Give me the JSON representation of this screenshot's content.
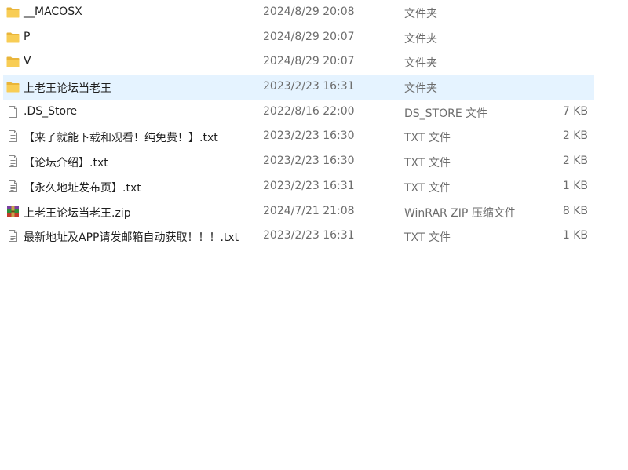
{
  "files": [
    {
      "name": "__MACOSX",
      "date": "2024/8/29 20:08",
      "type": "文件夹",
      "size": "",
      "icon": "folder-icon"
    },
    {
      "name": "P",
      "date": "2024/8/29 20:07",
      "type": "文件夹",
      "size": "",
      "icon": "folder-icon"
    },
    {
      "name": "V",
      "date": "2024/8/29 20:07",
      "type": "文件夹",
      "size": "",
      "icon": "folder-icon"
    },
    {
      "name": "上老王论坛当老王",
      "date": "2023/2/23 16:31",
      "type": "文件夹",
      "size": "",
      "icon": "folder-icon",
      "selected": true
    },
    {
      "name": ".DS_Store",
      "date": "2022/8/16 22:00",
      "type": "DS_STORE 文件",
      "size": "7 KB",
      "icon": "file-icon"
    },
    {
      "name": "【来了就能下载和观看！纯免费！】.txt",
      "date": "2023/2/23 16:30",
      "type": "TXT 文件",
      "size": "2 KB",
      "icon": "text-file-icon"
    },
    {
      "name": "【论坛介绍】.txt",
      "date": "2023/2/23 16:30",
      "type": "TXT 文件",
      "size": "2 KB",
      "icon": "text-file-icon"
    },
    {
      "name": "【永久地址发布页】.txt",
      "date": "2023/2/23 16:31",
      "type": "TXT 文件",
      "size": "1 KB",
      "icon": "text-file-icon"
    },
    {
      "name": "上老王论坛当老王.zip",
      "date": "2024/7/21 21:08",
      "type": "WinRAR ZIP 压缩文件",
      "size": "8 KB",
      "icon": "winrar-archive-icon"
    },
    {
      "name": "最新地址及APP请发邮箱自动获取！！！.txt",
      "date": "2023/2/23 16:31",
      "type": "TXT 文件",
      "size": "1 KB",
      "icon": "text-file-icon"
    }
  ],
  "colors": {
    "selection": "#e5f3ff",
    "folder": "#f3c44f",
    "meta_text": "#6d6d6d"
  }
}
